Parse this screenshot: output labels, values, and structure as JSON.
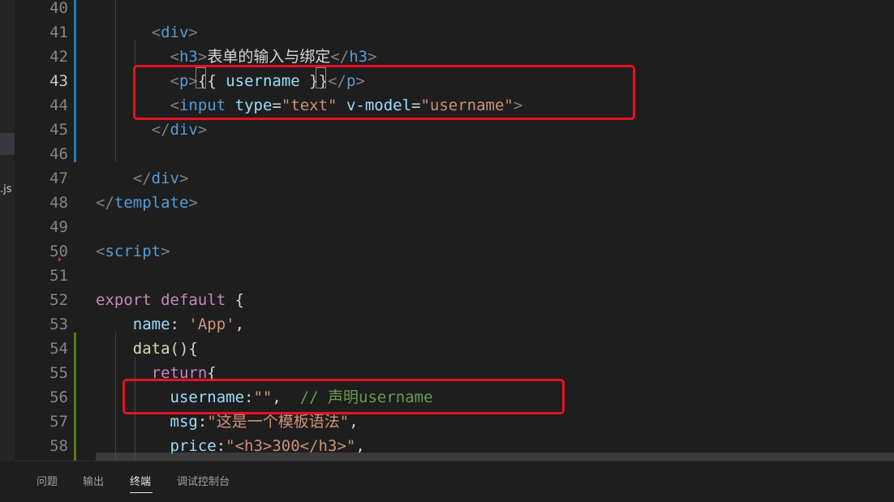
{
  "sidebar": {
    "file_fragment": ".js"
  },
  "editor": {
    "lines": [
      {
        "num": "40",
        "tokens": []
      },
      {
        "num": "41",
        "tokens": [
          {
            "t": "      ",
            "c": "t-text"
          },
          {
            "t": "<",
            "c": "t-punc"
          },
          {
            "t": "div",
            "c": "t-tag"
          },
          {
            "t": ">",
            "c": "t-punc"
          }
        ]
      },
      {
        "num": "42",
        "tokens": [
          {
            "t": "        ",
            "c": "t-text"
          },
          {
            "t": "<",
            "c": "t-punc"
          },
          {
            "t": "h3",
            "c": "t-tag"
          },
          {
            "t": ">",
            "c": "t-punc"
          },
          {
            "t": "表单的输入与绑定",
            "c": "t-text"
          },
          {
            "t": "</",
            "c": "t-punc"
          },
          {
            "t": "h3",
            "c": "t-tag"
          },
          {
            "t": ">",
            "c": "t-punc"
          }
        ]
      },
      {
        "num": "43",
        "active": true,
        "tokens": [
          {
            "t": "        ",
            "c": "t-text"
          },
          {
            "t": "<",
            "c": "t-punc"
          },
          {
            "t": "p",
            "c": "t-tag"
          },
          {
            "t": ">",
            "c": "t-punc"
          },
          {
            "t": "{{ ",
            "c": "t-text"
          },
          {
            "t": "username",
            "c": "t-attr"
          },
          {
            "t": " }}",
            "c": "t-text"
          },
          {
            "t": "</",
            "c": "t-punc"
          },
          {
            "t": "p",
            "c": "t-tag"
          },
          {
            "t": ">",
            "c": "t-punc"
          }
        ]
      },
      {
        "num": "44",
        "tokens": [
          {
            "t": "        ",
            "c": "t-text"
          },
          {
            "t": "<",
            "c": "t-punc"
          },
          {
            "t": "input",
            "c": "t-tag"
          },
          {
            "t": " ",
            "c": "t-text"
          },
          {
            "t": "type",
            "c": "t-attr"
          },
          {
            "t": "=",
            "c": "t-text"
          },
          {
            "t": "\"text\"",
            "c": "t-str"
          },
          {
            "t": " ",
            "c": "t-text"
          },
          {
            "t": "v-model",
            "c": "t-attr"
          },
          {
            "t": "=",
            "c": "t-text"
          },
          {
            "t": "\"username\"",
            "c": "t-str"
          },
          {
            "t": ">",
            "c": "t-punc"
          }
        ]
      },
      {
        "num": "45",
        "tokens": [
          {
            "t": "      ",
            "c": "t-text"
          },
          {
            "t": "</",
            "c": "t-punc"
          },
          {
            "t": "div",
            "c": "t-tag"
          },
          {
            "t": ">",
            "c": "t-punc"
          }
        ]
      },
      {
        "num": "46",
        "tokens": []
      },
      {
        "num": "47",
        "tokens": [
          {
            "t": "    ",
            "c": "t-text"
          },
          {
            "t": "</",
            "c": "t-punc"
          },
          {
            "t": "div",
            "c": "t-tag"
          },
          {
            "t": ">",
            "c": "t-punc"
          }
        ]
      },
      {
        "num": "48",
        "tokens": [
          {
            "t": "</",
            "c": "t-punc"
          },
          {
            "t": "template",
            "c": "t-tag"
          },
          {
            "t": ">",
            "c": "t-punc"
          }
        ]
      },
      {
        "num": "49",
        "tokens": []
      },
      {
        "num": "50",
        "tokens": [
          {
            "t": "<",
            "c": "t-punc"
          },
          {
            "t": "script",
            "c": "t-tag"
          },
          {
            "t": ">",
            "c": "t-punc"
          }
        ]
      },
      {
        "num": "51",
        "tokens": []
      },
      {
        "num": "52",
        "tokens": [
          {
            "t": "export",
            "c": "t-key"
          },
          {
            "t": " ",
            "c": "t-text"
          },
          {
            "t": "default",
            "c": "t-key"
          },
          {
            "t": " {",
            "c": "t-text"
          }
        ]
      },
      {
        "num": "53",
        "tokens": [
          {
            "t": "    ",
            "c": "t-text"
          },
          {
            "t": "name",
            "c": "t-var"
          },
          {
            "t": ": ",
            "c": "t-text"
          },
          {
            "t": "'App'",
            "c": "t-str"
          },
          {
            "t": ",",
            "c": "t-text"
          }
        ]
      },
      {
        "num": "54",
        "tokens": [
          {
            "t": "    ",
            "c": "t-text"
          },
          {
            "t": "data",
            "c": "t-fn"
          },
          {
            "t": "(){",
            "c": "t-text"
          }
        ]
      },
      {
        "num": "55",
        "tokens": [
          {
            "t": "      ",
            "c": "t-text"
          },
          {
            "t": "return",
            "c": "t-key"
          },
          {
            "t": "{",
            "c": "t-text"
          }
        ]
      },
      {
        "num": "56",
        "tokens": [
          {
            "t": "        ",
            "c": "t-text"
          },
          {
            "t": "username",
            "c": "t-var"
          },
          {
            "t": ":",
            "c": "t-text"
          },
          {
            "t": "\"\"",
            "c": "t-str"
          },
          {
            "t": ",  ",
            "c": "t-text"
          },
          {
            "t": "// 声明username",
            "c": "t-com"
          }
        ]
      },
      {
        "num": "57",
        "tokens": [
          {
            "t": "        ",
            "c": "t-text"
          },
          {
            "t": "msg",
            "c": "t-var"
          },
          {
            "t": ":",
            "c": "t-text"
          },
          {
            "t": "\"这是一个模板语法\"",
            "c": "t-str"
          },
          {
            "t": ",",
            "c": "t-text"
          }
        ]
      },
      {
        "num": "58",
        "tokens": [
          {
            "t": "        ",
            "c": "t-text"
          },
          {
            "t": "price",
            "c": "t-var"
          },
          {
            "t": ":",
            "c": "t-text"
          },
          {
            "t": "\"<h3>300</h3>\"",
            "c": "t-str"
          },
          {
            "t": ",",
            "c": "t-text"
          }
        ]
      }
    ]
  },
  "panel": {
    "tabs": [
      {
        "label": "问题"
      },
      {
        "label": "输出"
      },
      {
        "label": "终端",
        "active": true
      },
      {
        "label": "调试控制台"
      }
    ]
  },
  "colors": {
    "accent": "#e81123",
    "gutter_modified": "#1b81a8",
    "gutter_added": "#587c0c"
  }
}
